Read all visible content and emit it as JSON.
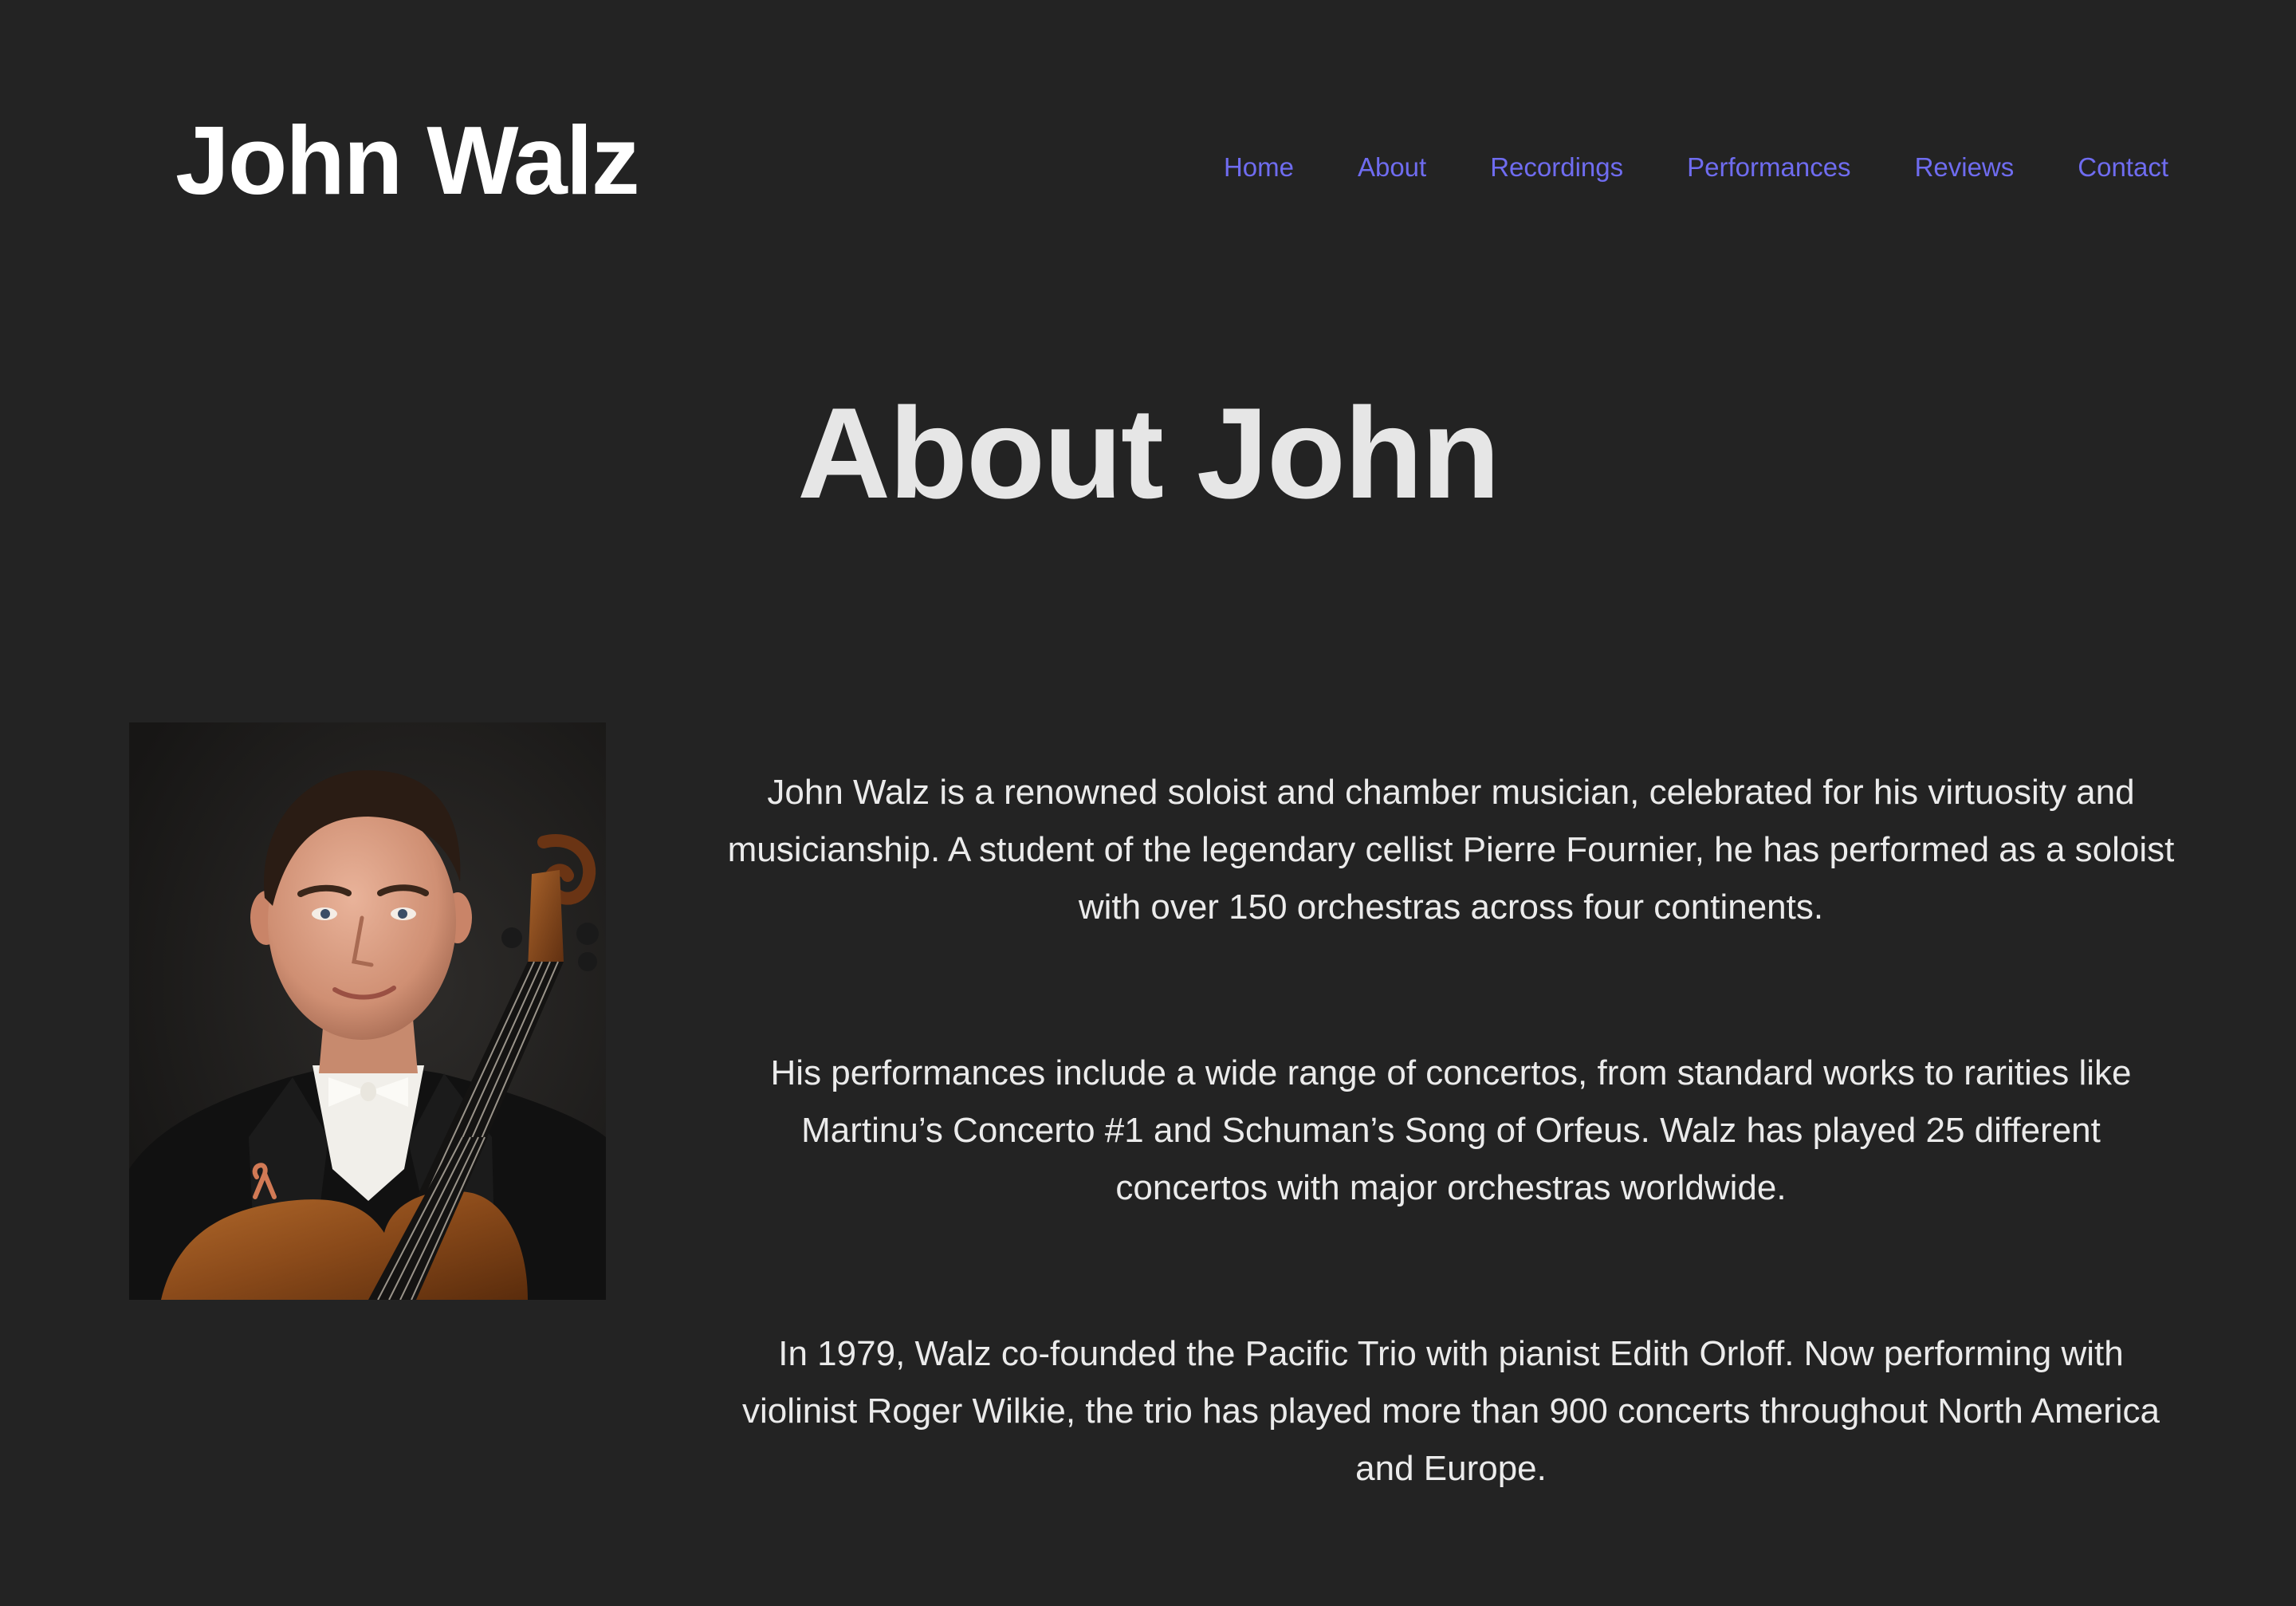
{
  "site": {
    "title": "John Walz"
  },
  "nav": {
    "items": [
      {
        "label": "Home"
      },
      {
        "label": "About"
      },
      {
        "label": "Recordings"
      },
      {
        "label": "Performances"
      },
      {
        "label": "Reviews"
      },
      {
        "label": "Contact"
      }
    ]
  },
  "main": {
    "heading": "About John",
    "portrait": {
      "alt": "Portrait of John Walz holding a cello"
    },
    "paragraphs": [
      "John Walz is a renowned soloist and chamber musician, celebrated for his virtuosity and musicianship. A student of the legendary cellist Pierre Fournier, he has performed as a soloist with over 150 orchestras across four continents.",
      "His performances include a wide range of concertos, from standard works to rarities like Martinu’s Concerto #1 and Schuman’s Song of Orfeus. Walz has played 25 different concertos with major orchestras worldwide.",
      "In 1979, Walz co-founded the Pacific Trio with pianist Edith Orloff. Now performing with violinist Roger Wilkie, the trio has played more than 900 concerts throughout North America and Europe."
    ]
  },
  "colors": {
    "background": "#232323",
    "nav_link": "#6f6cf0",
    "title": "#ffffff",
    "heading": "#e6e6e6",
    "body_text": "#ebebeb"
  }
}
